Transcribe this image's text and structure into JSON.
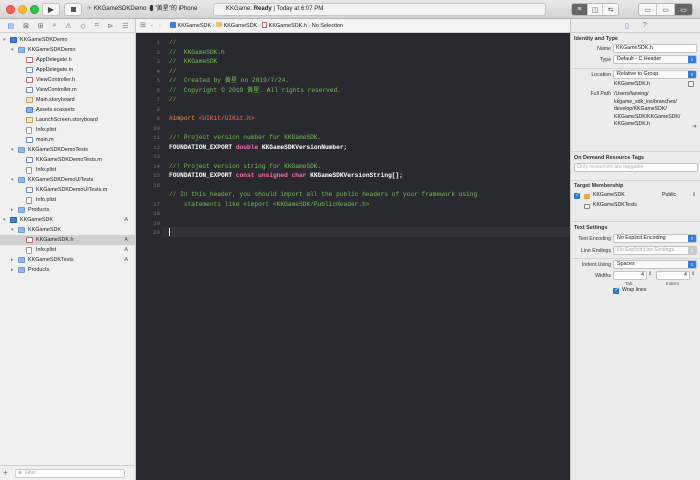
{
  "toolbar": {
    "scheme": "KKGameSDKDemo",
    "destination": "\"黄星\"的 iPhone",
    "status_app": "KKGame:",
    "status_state": "Ready",
    "status_time": "Today at 6:07 PM",
    "run_icon": "play-icon",
    "stop_icon": "stop-icon"
  },
  "navigator": {
    "tree": [
      {
        "label": "KKGameSDKDemo",
        "indent": 0,
        "icon": "proj",
        "disc": "▾",
        "badge": ""
      },
      {
        "label": "KKGameSDKDemo",
        "indent": 1,
        "icon": "folder",
        "disc": "▾",
        "badge": ""
      },
      {
        "label": "AppDelegate.h",
        "indent": 2,
        "icon": "h",
        "disc": "",
        "badge": ""
      },
      {
        "label": "AppDelegate.m",
        "indent": 2,
        "icon": "m",
        "disc": "",
        "badge": ""
      },
      {
        "label": "ViewController.h",
        "indent": 2,
        "icon": "h",
        "disc": "",
        "badge": ""
      },
      {
        "label": "ViewController.m",
        "indent": 2,
        "icon": "m",
        "disc": "",
        "badge": ""
      },
      {
        "label": "Main.storyboard",
        "indent": 2,
        "icon": "sb",
        "disc": "",
        "badge": ""
      },
      {
        "label": "Assets.xcassets",
        "indent": 2,
        "icon": "xca",
        "disc": "",
        "badge": ""
      },
      {
        "label": "LaunchScreen.storyboard",
        "indent": 2,
        "icon": "sb",
        "disc": "",
        "badge": ""
      },
      {
        "label": "Info.plist",
        "indent": 2,
        "icon": "file",
        "disc": "",
        "badge": ""
      },
      {
        "label": "main.m",
        "indent": 2,
        "icon": "m",
        "disc": "",
        "badge": ""
      },
      {
        "label": "KKGameSDKDemoTests",
        "indent": 1,
        "icon": "folder",
        "disc": "▾",
        "badge": ""
      },
      {
        "label": "KKGameSDKDemoTests.m",
        "indent": 2,
        "icon": "m",
        "disc": "",
        "badge": ""
      },
      {
        "label": "Info.plist",
        "indent": 2,
        "icon": "file",
        "disc": "",
        "badge": ""
      },
      {
        "label": "KKGameSDKDemoUITests",
        "indent": 1,
        "icon": "folder",
        "disc": "▾",
        "badge": ""
      },
      {
        "label": "KKGameSDKDemoUITests.m",
        "indent": 2,
        "icon": "m",
        "disc": "",
        "badge": ""
      },
      {
        "label": "Info.plist",
        "indent": 2,
        "icon": "file",
        "disc": "",
        "badge": ""
      },
      {
        "label": "Products",
        "indent": 1,
        "icon": "folder",
        "disc": "▸",
        "badge": ""
      },
      {
        "label": "KKGameSDK",
        "indent": 0,
        "icon": "proj",
        "disc": "▾",
        "badge": "A"
      },
      {
        "label": "KKGameSDK",
        "indent": 1,
        "icon": "folder",
        "disc": "▾",
        "badge": ""
      },
      {
        "label": "KKGameSDK.h",
        "indent": 2,
        "icon": "h",
        "disc": "",
        "badge": "A"
      },
      {
        "label": "Info.plist",
        "indent": 2,
        "icon": "file",
        "disc": "",
        "badge": "A"
      },
      {
        "label": "KKGameSDKTests",
        "indent": 1,
        "icon": "folder",
        "disc": "▸",
        "badge": "A"
      },
      {
        "label": "Products",
        "indent": 1,
        "icon": "folder",
        "disc": "▸",
        "badge": ""
      }
    ],
    "selected_index": 20,
    "filter_placeholder": "Filter",
    "add_icon": "plus-icon"
  },
  "jumpbar": {
    "crumbs": [
      "KKGameSDK",
      "KKGameSDK",
      "KKGameSDK.h",
      "No Selection"
    ]
  },
  "editor": {
    "lines": [
      [
        {
          "t": "//",
          "c": "c"
        }
      ],
      [
        {
          "t": "//  KKGameSDK.h",
          "c": "c"
        }
      ],
      [
        {
          "t": "//  KKGameSDK",
          "c": "c"
        }
      ],
      [
        {
          "t": "//",
          "c": "c"
        }
      ],
      [
        {
          "t": "//  Created by 黄星 on 2019/7/24.",
          "c": "c"
        }
      ],
      [
        {
          "t": "//  Copyright © 2019 黄星. All rights reserved.",
          "c": "c"
        }
      ],
      [
        {
          "t": "//",
          "c": "c"
        }
      ],
      [],
      [
        {
          "t": "#import ",
          "c": "pp"
        },
        {
          "t": "<UIKit/UIKit.h>",
          "c": "str"
        }
      ],
      [],
      [
        {
          "t": "//! Project version number for KKGameSDK.",
          "c": "c"
        }
      ],
      [
        {
          "t": "FOUNDATION_EXPORT ",
          "c": "id"
        },
        {
          "t": "double",
          "c": "kw"
        },
        {
          "t": " KKGameSDKVersionNumber;",
          "c": "id"
        }
      ],
      [],
      [
        {
          "t": "//! Project version string for KKGameSDK.",
          "c": "c"
        }
      ],
      [
        {
          "t": "FOUNDATION_EXPORT ",
          "c": "id"
        },
        {
          "t": "const unsigned char",
          "c": "kw"
        },
        {
          "t": " KKGameSDKVersionString[];",
          "c": "id"
        }
      ],
      [],
      [
        {
          "t": "// In this header, you should import all the public headers of your framework using",
          "c": "c"
        }
      ],
      [
        {
          "t": "    statements like #import <KKGameSDK/PublicHeader.h>",
          "c": "c"
        }
      ],
      [],
      [],
      []
    ],
    "line_numbers": [
      "1",
      "2",
      "3",
      "4",
      "5",
      "6",
      "7",
      "8",
      "9",
      "10",
      "11",
      "12",
      "13",
      "14",
      "15",
      "16",
      "",
      "17",
      "18",
      "19",
      "20"
    ]
  },
  "inspector": {
    "identity_title": "Identity and Type",
    "name_label": "Name",
    "name_value": "KKGameSDK.h",
    "type_label": "Type",
    "type_value": "Default - C Header",
    "location_label": "Location",
    "location_value": "Relative to Group",
    "location_file": "KKGameSDK.h",
    "fullpath_label": "Full Path",
    "fullpath_lines": [
      "/Users/fanxing/",
      "kkgame_sdk_ios/branches/",
      "develop/KKGameSDK/",
      "KKGameSDK/KKGameSDK/",
      "KKGameSDK.h"
    ],
    "odr_title": "On Demand Resource Tags",
    "odr_placeholder": "Only resources are taggable",
    "membership_title": "Target Membership",
    "targets": [
      {
        "name": "KKGameSDK",
        "checked": true,
        "visibility": "Public"
      },
      {
        "name": "KKGameSDKTests",
        "checked": false,
        "visibility": ""
      }
    ],
    "text_settings_title": "Text Settings",
    "encoding_label": "Text Encoding",
    "encoding_value": "No Explicit Encoding",
    "endings_label": "Line Endings",
    "endings_value": "No Explicit Line Endings",
    "indent_label": "Indent Using",
    "indent_value": "Spaces",
    "widths_label": "Widths",
    "tab_width": "4",
    "indent_width": "4",
    "tab_caption": "Tab",
    "indent_caption": "Indent",
    "wrap_label": "Wrap lines",
    "wrap_checked": true
  }
}
